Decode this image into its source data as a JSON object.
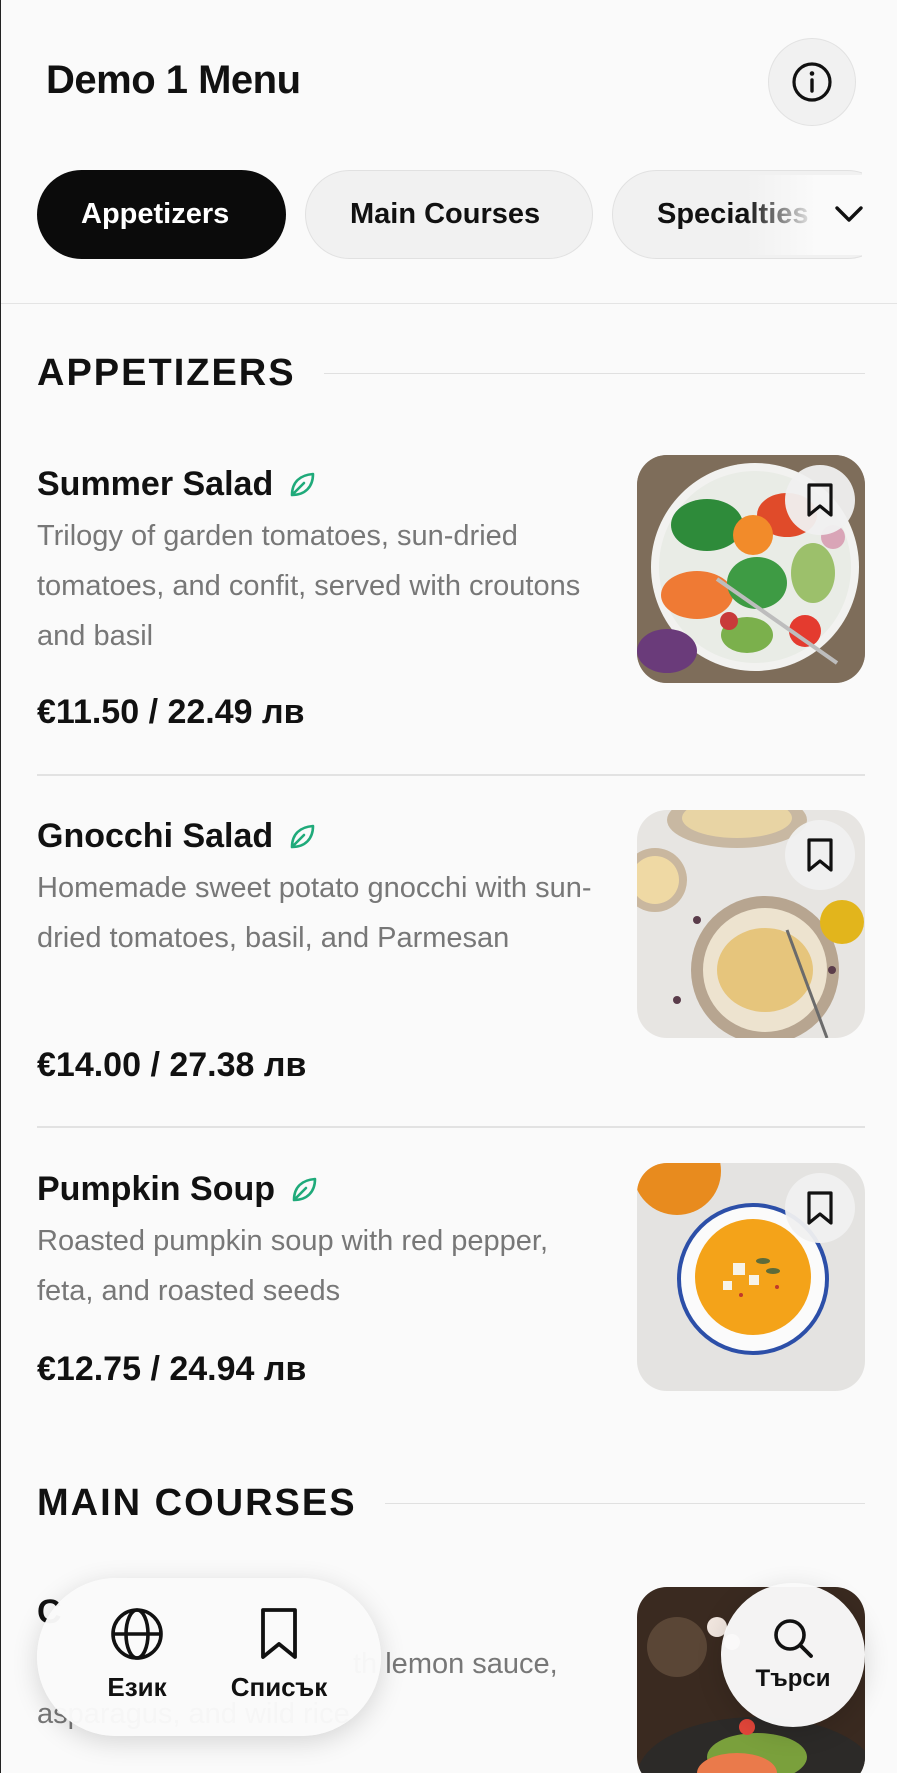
{
  "header": {
    "title": "Demo 1 Menu",
    "info_icon": "info-icon"
  },
  "tabs": [
    {
      "label": "Appetizers",
      "active": true
    },
    {
      "label": "Main Courses",
      "active": false
    },
    {
      "label": "Specialties",
      "active": false
    }
  ],
  "sections": [
    {
      "title": "APPETIZERS",
      "items": [
        {
          "name": "Summer Salad",
          "vegetarian": true,
          "description": "Trilogy of garden tomatoes, sun-dried tomatoes, and confit, served with croutons and basil",
          "price": "€11.50 / 22.49 лв",
          "image": "salad-bowl"
        },
        {
          "name": "Gnocchi Salad",
          "vegetarian": true,
          "description": "Homemade sweet potato gnocchi with sun-dried tomatoes, basil, and Parmesan",
          "price": "€14.00 / 27.38 лв",
          "image": "pasta-plate"
        },
        {
          "name": "Pumpkin Soup",
          "vegetarian": true,
          "description": "Roasted pumpkin soup with red pepper, feta, and roasted seeds",
          "price": "€12.75 / 24.94 лв",
          "image": "soup-bowl"
        }
      ]
    },
    {
      "title": "MAIN COURSES",
      "items": [
        {
          "name": "C",
          "description": "th lemon sauce, asparagus, and wild rice",
          "image": "salmon-plate"
        }
      ]
    }
  ],
  "bottom_nav": {
    "language_label": "Език",
    "list_label": "Списък",
    "search_label": "Търси"
  },
  "colors": {
    "accent_active_tab": "#0b0b0b",
    "vegetarian_leaf": "#1faa7a",
    "price": "#111111",
    "description": "#777777"
  }
}
